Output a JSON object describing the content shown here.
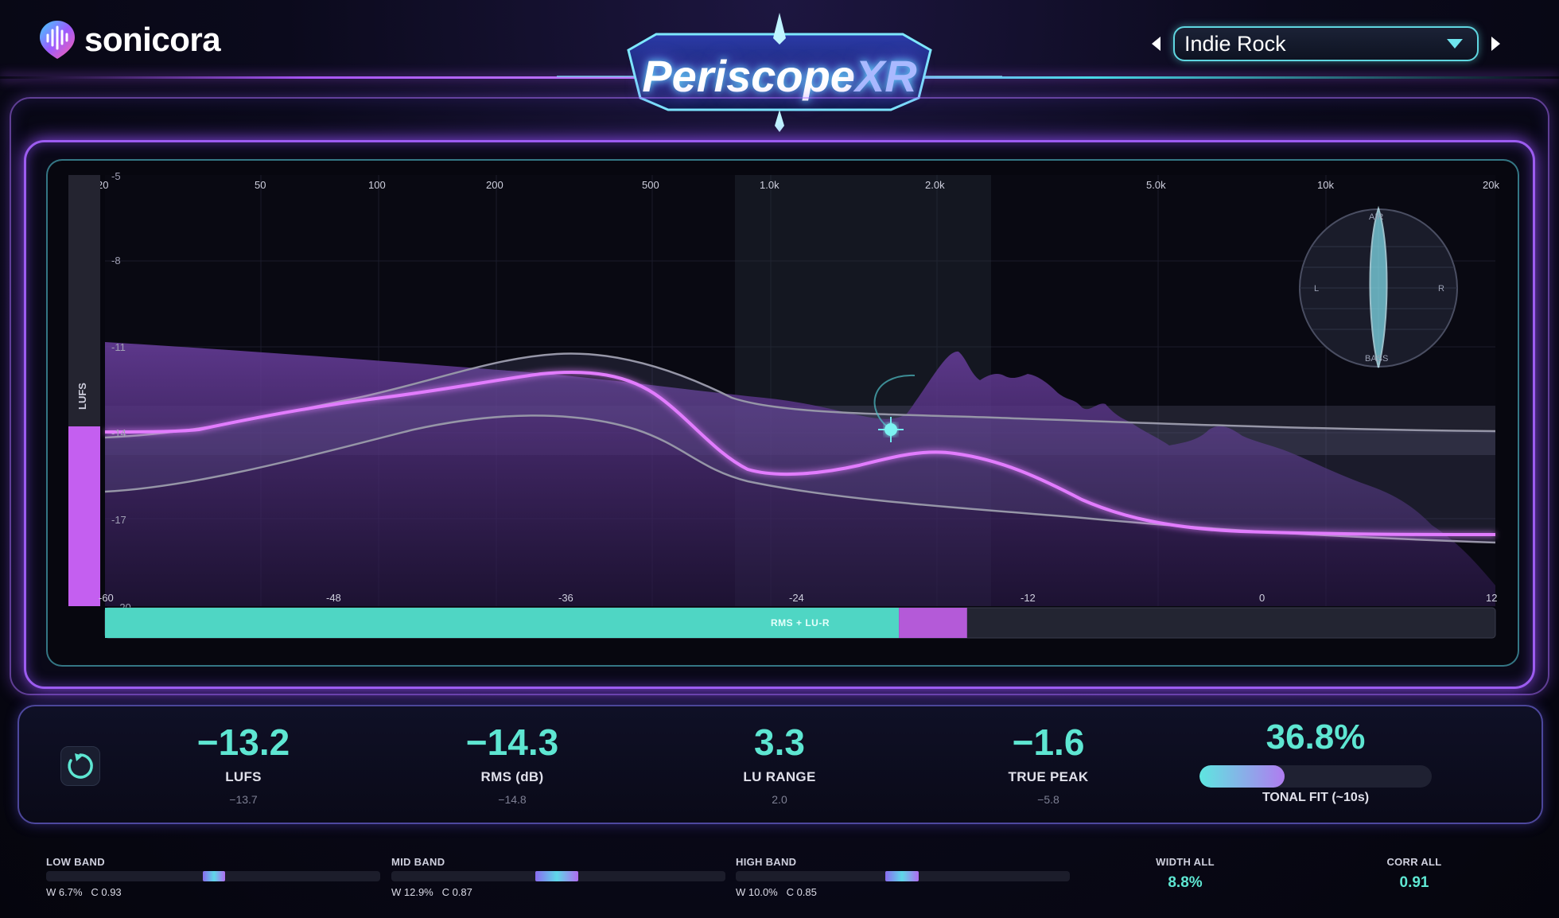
{
  "brand": {
    "name": "sonicora"
  },
  "plugin": {
    "name_main": "Periscope",
    "name_suffix": "XR"
  },
  "preset": {
    "selected": "Indie Rock"
  },
  "plot": {
    "freq_ticks": [
      "20",
      "50",
      "100",
      "200",
      "500",
      "1.0k",
      "2.0k",
      "5.0k",
      "10k",
      "20k"
    ],
    "db_ticks": [
      "-5",
      "-8",
      "-11",
      "-14",
      "-17",
      "-20"
    ],
    "meter_ticks": [
      "-60",
      "-48",
      "-36",
      "-24",
      "-12",
      "0",
      "12"
    ],
    "lufs_axis_label": "LUFS",
    "meter_bar_label": "RMS + LU-R",
    "meter_rms_fraction": 0.571,
    "meter_lur_fraction": 0.049,
    "lufs_meter_fraction": 0.417,
    "vectorscope": {
      "top": "AIR",
      "bottom": "BASS",
      "left": "L",
      "right": "R"
    }
  },
  "stats": {
    "lufs": {
      "value": "−13.2",
      "label": "LUFS",
      "sub": "−13.7"
    },
    "rms": {
      "value": "−14.3",
      "label": "RMS (dB)",
      "sub": "−14.8"
    },
    "lu_range": {
      "value": "3.3",
      "label": "LU RANGE",
      "sub": "2.0"
    },
    "true_peak": {
      "value": "−1.6",
      "label": "TRUE PEAK",
      "sub": "−5.8"
    },
    "tonal_fit": {
      "value": "36.8%",
      "label": "TONAL FIT (~10s)",
      "fraction": 0.368
    }
  },
  "bands": [
    {
      "title": "LOW BAND",
      "meta": "W 6.7%   C 0.93",
      "marker_start": 0.47,
      "marker_width": 0.066
    },
    {
      "title": "MID BAND",
      "meta": "W 12.9%   C 0.87",
      "marker_start": 0.43,
      "marker_width": 0.13
    },
    {
      "title": "HIGH BAND",
      "meta": "W 10.0%   C 0.85",
      "marker_start": 0.447,
      "marker_width": 0.1
    }
  ],
  "summary": {
    "width_all": {
      "label": "WIDTH ALL",
      "value": "8.8%"
    },
    "corr_all": {
      "label": "CORR ALL",
      "value": "0.91"
    }
  },
  "colors": {
    "accent_teal": "#5ee6d2",
    "accent_purple": "#c45ff0",
    "curve_magenta": "#e27cff"
  },
  "icons": {
    "brand": "waveform-pin-icon",
    "reset": "refresh-icon",
    "prev": "triangle-left-icon",
    "next": "triangle-right-icon"
  }
}
